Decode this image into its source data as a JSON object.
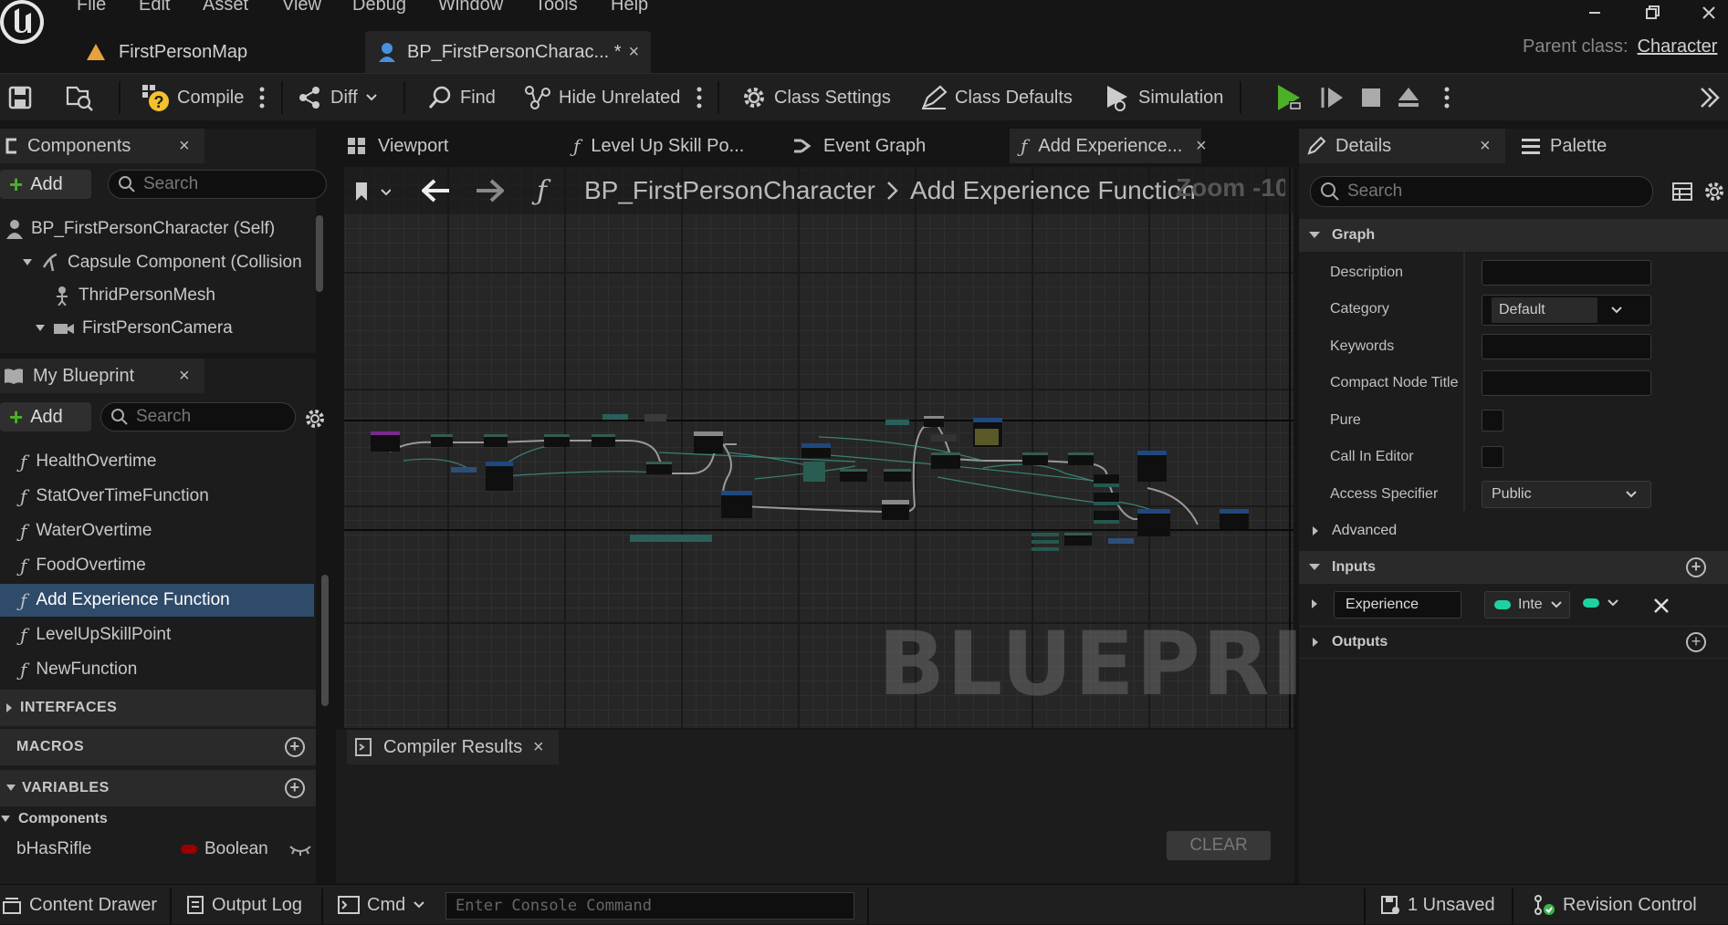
{
  "menu": {
    "file": "File",
    "edit": "Edit",
    "asset": "Asset",
    "view": "View",
    "debug": "Debug",
    "window": "Window",
    "tools": "Tools",
    "help": "Help"
  },
  "doc_tabs": {
    "tab1": "FirstPersonMap",
    "tab2": "BP_FirstPersonCharac... *"
  },
  "parent_class": {
    "label": "Parent class:",
    "value": "Character"
  },
  "toolbar": {
    "compile": "Compile",
    "diff": "Diff",
    "find": "Find",
    "hide_unrelated": "Hide Unrelated",
    "class_settings": "Class Settings",
    "class_defaults": "Class Defaults",
    "simulation": "Simulation"
  },
  "components": {
    "tab": "Components",
    "add": "Add",
    "search_placeholder": "Search",
    "items": [
      "BP_FirstPersonCharacter (Self)",
      "Capsule Component (Collision",
      "ThridPersonMesh",
      "FirstPersonCamera"
    ]
  },
  "my_blueprint": {
    "tab": "My Blueprint",
    "add": "Add",
    "search_placeholder": "Search",
    "functions": [
      "HealthOvertime",
      "StatOverTimeFunction",
      "WaterOvertime",
      "FoodOvertime",
      "Add Experience Function",
      "LevelUpSkillPoint",
      "NewFunction"
    ],
    "interfaces": "INTERFACES",
    "macros": "MACROS",
    "variables": "VARIABLES",
    "components_cat": "Components",
    "var_name": "bHasRifle",
    "var_type": "Boolean"
  },
  "graph_tabs": {
    "viewport": "Viewport",
    "levelup": "Level Up Skill Po...",
    "event_graph": "Event Graph",
    "add_exp": "Add Experience..."
  },
  "breadcrumb": {
    "root": "BP_FirstPersonCharacter",
    "current": "Add Experience Function",
    "zoom": "Zoom -10"
  },
  "graph": {
    "watermark": "BLUEPRINT"
  },
  "compiler": {
    "tab": "Compiler Results",
    "clear": "CLEAR"
  },
  "details": {
    "tab": "Details",
    "palette": "Palette",
    "search_placeholder": "Search",
    "graph_section": "Graph",
    "labels": {
      "description": "Description",
      "category": "Category",
      "keywords": "Keywords",
      "compact": "Compact Node Title",
      "pure": "Pure",
      "call_in_editor": "Call In Editor",
      "access": "Access Specifier"
    },
    "category_value": "Default",
    "access_value": "Public",
    "advanced": "Advanced",
    "inputs": "Inputs",
    "input_name": "Experience",
    "input_type": "Inte",
    "outputs": "Outputs"
  },
  "statusbar": {
    "content_drawer": "Content Drawer",
    "output_log": "Output Log",
    "cmd": "Cmd",
    "console_placeholder": "Enter Console Command",
    "unsaved": "1 Unsaved",
    "revision": "Revision Control"
  },
  "colors": {
    "selected_row": "#2f4b6a",
    "integer_pin": "#1dd1a1",
    "boolean_pin": "#9b0000",
    "play_green": "#4caf2a",
    "bg": "#151515",
    "panel": "#1f1f1f"
  }
}
